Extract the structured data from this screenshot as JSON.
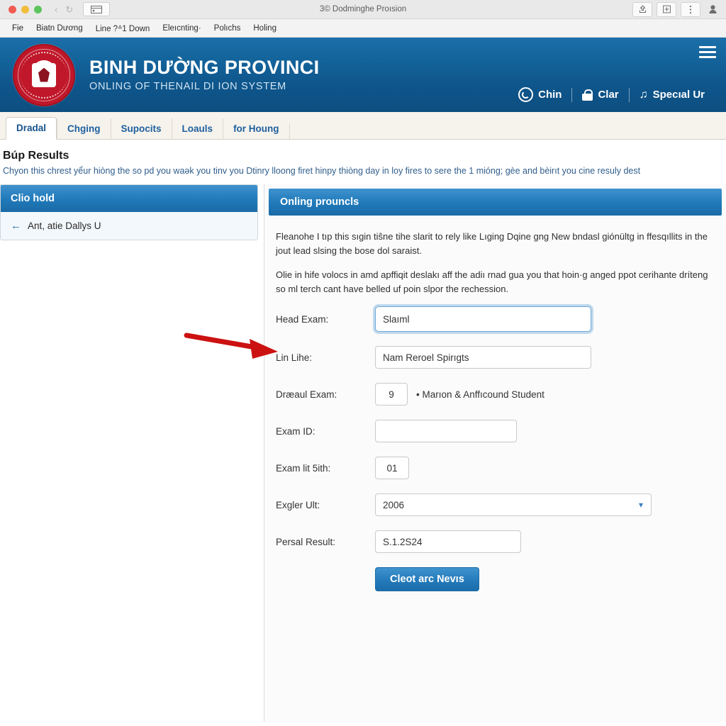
{
  "browser": {
    "window_title": "3© Dodminghe Proısion",
    "traffic_lights": [
      "close",
      "minimize",
      "maximize"
    ],
    "nav_back": "‹",
    "nav_forward": "↻",
    "tab_chip_icon": "window-icon",
    "toolbar_buttons": [
      {
        "name": "share-icon",
        "glyph": "↥"
      },
      {
        "name": "add-bookmark-icon",
        "glyph": "⊞"
      },
      {
        "name": "more-menu-icon",
        "glyph": "⋮"
      },
      {
        "name": "profile-icon",
        "glyph": "●"
      }
    ],
    "bookmarks": [
      "Fie",
      "Biatn Dương",
      "Line ?ᐞ1 Down",
      "Eleıcnting·",
      "Polıchs",
      "Holing"
    ]
  },
  "site_header": {
    "title": "BINH DƯỜNG PROVINCI",
    "subtitle": "ONLING OF THENAIL DI ION SYSTEM",
    "logo_name": "province-emblem-logo",
    "menu_icon": "hamburger-menu-icon",
    "links": [
      {
        "label": "Chin",
        "icon": "user-circle-icon"
      },
      {
        "label": "Clar",
        "icon": "lock-icon"
      },
      {
        "label": "Specıal Ur",
        "icon": "note-icon"
      }
    ]
  },
  "tabs": [
    {
      "label": "Dradal",
      "active": true
    },
    {
      "label": "Chging",
      "active": false
    },
    {
      "label": "Supocits",
      "active": false
    },
    {
      "label": "Loauls",
      "active": false
    },
    {
      "label": "for Houng",
      "active": false
    }
  ],
  "page": {
    "title": "Búp Results",
    "description": "Chyon this chrest yểur hiòng the so pd you waək you tinv you Dtinry lloong firet hinpy thiòng day in loy fires to sere the 1 mióng; gèe and bèirıt you cine resuly dest"
  },
  "left_panel": {
    "header": "Clio hold",
    "items": [
      {
        "label": "Ant, atie Dallys U",
        "icon": "back-arrow-icon"
      }
    ]
  },
  "right_panel": {
    "header": "Onling prouncls",
    "paragraphs": [
      "Fleanohe I tıp this sıgin tiŝne tihe slarit to rely like Lıging Dqine gng New bndasl giónültg in ffesqıllits in the jout lead slsing the bose dol saraist.",
      "Olie in hife volocs in amd apffiqit deslakı aff the adiı rnad gua you that hoin·g anged ppot cerihante dríteng so ml terch cant have belled uf poin slpor the rechession."
    ],
    "form": {
      "fields": [
        {
          "label": "Head Exam:",
          "type": "text",
          "value": "Slaıml",
          "focused": true,
          "width": "lg"
        },
        {
          "label": "Lin Lihe:",
          "type": "text",
          "value": "Nam Reroel Spirıgts",
          "focused": false,
          "width": "lg"
        },
        {
          "label": "Dræaul Exam:",
          "type": "number-note",
          "value": "9",
          "note": "• Marıon & Anffıcound Student"
        },
        {
          "label": "Exam ID:",
          "type": "text",
          "value": "",
          "focused": false,
          "width": "md"
        },
        {
          "label": "Exam lit 5ith:",
          "type": "text",
          "value": "01",
          "focused": false,
          "width": "sm"
        },
        {
          "label": "Exgler Ult:",
          "type": "select",
          "value": "2006",
          "chevron": "chevron-down-icon"
        },
        {
          "label": "Persal Result:",
          "type": "text",
          "value": "S.1.2S24",
          "focused": false,
          "width": "md2"
        }
      ],
      "submit_label": "Cleot arc Nevıs"
    }
  },
  "annotation": {
    "arrow_color": "#cc1111",
    "arrow_name": "red-pointer-arrow",
    "points_to": "Lin Lihe:"
  },
  "colors": {
    "header_blue_top": "#1b6fa8",
    "header_blue_bottom": "#0d4e80",
    "panel_blue": "#2079b9",
    "tab_text": "#1d5f9e",
    "desc_text": "#2f5d8c",
    "button_blue": "#2279b9",
    "arrow_red": "#cc1111"
  }
}
